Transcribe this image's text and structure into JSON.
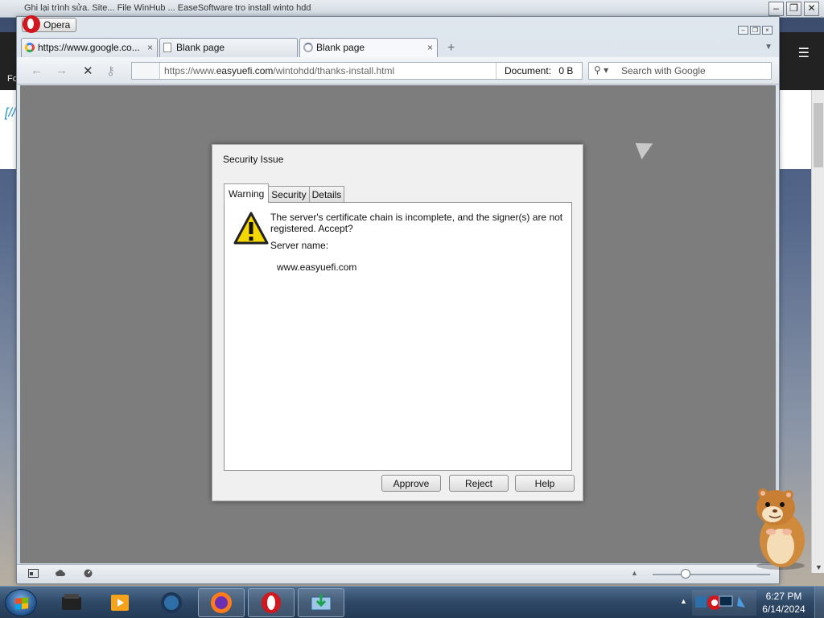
{
  "background": {
    "top_text": "Ghi lại trình sửa. Site... File WinHub   ... EaseSoftware tro install winto hdd",
    "left_label": "Fo"
  },
  "window": {
    "app_button": "Opera",
    "minimize": "–",
    "restore": "❐",
    "close": "×"
  },
  "tabs": [
    {
      "label": "https://www.google.co...",
      "icon": "google-icon",
      "close": "×"
    },
    {
      "label": "Blank page",
      "icon": "page-icon",
      "close": ""
    },
    {
      "label": "Blank page",
      "icon": "loading-icon",
      "close": "×"
    }
  ],
  "new_tab": "+",
  "toolbar": {
    "back": "←",
    "forward": "→",
    "stop": "✕",
    "key": "⚷",
    "url_prefix": "https://www.",
    "url_domain": "easyuefi.com",
    "url_path": "/wintohdd/thanks-install.html",
    "doc_label": "Document:",
    "doc_size": "0 B",
    "search_placeholder": "Search with Google"
  },
  "dialog": {
    "title": "Security Issue",
    "tabs": [
      "Warning",
      "Security",
      "Details"
    ],
    "message": "The server's certificate chain is incomplete, and the signer(s) are not registered. Accept?",
    "server_label": "Server name:",
    "server_value": "www.easyuefi.com",
    "buttons": {
      "approve": "Approve",
      "reject": "Reject",
      "help": "Help"
    }
  },
  "taskbar": {
    "time": "6:27 PM",
    "date": "6/14/2024"
  },
  "colors": {
    "content_bg": "#7d7d7d",
    "dialog_bg": "#f0f0f0",
    "warning_yellow": "#f5d800",
    "taskbar": "#2e4866"
  }
}
